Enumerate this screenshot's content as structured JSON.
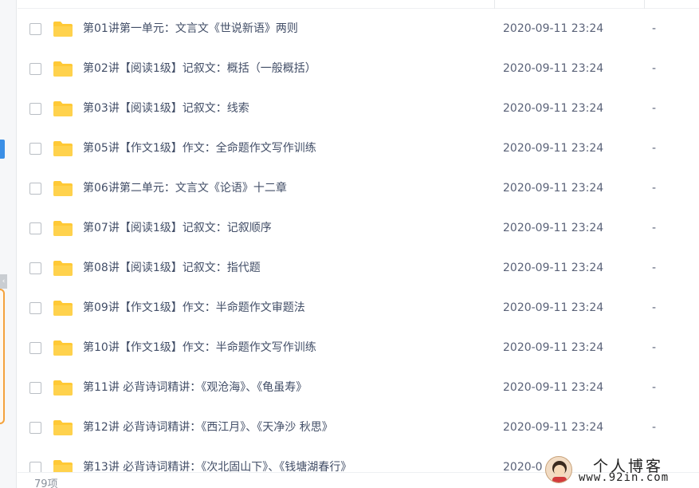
{
  "files": [
    {
      "name": "第01讲第一单元：文言文《世说新语》两则",
      "date": "2020-09-11 23:24",
      "size": "-"
    },
    {
      "name": "第02讲【阅读1级】记叙文：概括（一般概括）",
      "date": "2020-09-11 23:24",
      "size": "-"
    },
    {
      "name": "第03讲【阅读1级】记叙文：线索",
      "date": "2020-09-11 23:24",
      "size": "-"
    },
    {
      "name": "第05讲【作文1级】作文：全命题作文写作训练",
      "date": "2020-09-11 23:24",
      "size": "-"
    },
    {
      "name": "第06讲第二单元：文言文《论语》十二章",
      "date": "2020-09-11 23:24",
      "size": "-"
    },
    {
      "name": "第07讲【阅读1级】记叙文：记叙顺序",
      "date": "2020-09-11 23:24",
      "size": "-"
    },
    {
      "name": "第08讲【阅读1级】记叙文：指代题",
      "date": "2020-09-11 23:24",
      "size": "-"
    },
    {
      "name": "第09讲【作文1级】作文：半命题作文审题法",
      "date": "2020-09-11 23:24",
      "size": "-"
    },
    {
      "name": "第10讲【作文1级】作文：半命题作文写作训练",
      "date": "2020-09-11 23:24",
      "size": "-"
    },
    {
      "name": "第11讲 必背诗词精讲：《观沧海》、《龟虽寿》",
      "date": "2020-09-11 23:24",
      "size": "-"
    },
    {
      "name": "第12讲 必背诗词精讲：《西江月》、《天净沙 秋思》",
      "date": "2020-09-11 23:24",
      "size": "-"
    },
    {
      "name": "第13讲 必背诗词精讲：《次北固山下》、《钱塘湖春行》",
      "date": "2020-0",
      "size": ""
    }
  ],
  "footer": {
    "item_count": "79项"
  },
  "watermark": {
    "title": "个人博客",
    "url": "www.92in.com"
  },
  "icons": {
    "folder": "folder-icon",
    "collapse": "chevron-left-icon"
  },
  "colors": {
    "folder": "#ffc936",
    "text": "#424e67",
    "accent": "#3b8fe6",
    "panel_highlight": "#f4a23c"
  }
}
